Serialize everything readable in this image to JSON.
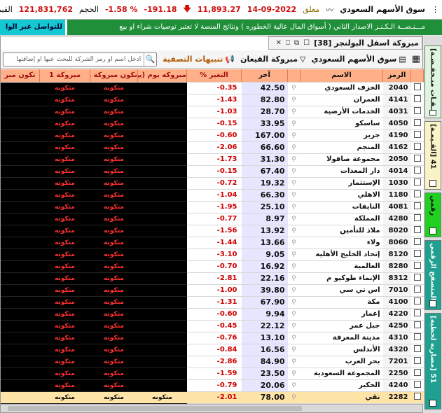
{
  "topbar": {
    "market_name": "سوق الأسهم السعودي",
    "status": "مغلق",
    "date": "14-09-2022",
    "index_value": "11,893.27",
    "index_change": "-191.18",
    "index_change_pct": "-1.58 %",
    "volume_label": "الحجم",
    "volume_value": "121,831,762",
    "value_label": "القيمة"
  },
  "banner": {
    "ticker_text": "مـــنـصــة الـكـنـز الاصدار الثاني ( أسواق المال عالية الخطوره ) ونتائج المنصة لا تعتبر توصيات شراء او بيع",
    "contact_label": "للتواصل عبر الوا"
  },
  "side_tabs": [
    {
      "label": "[صـفــقـات منـخفـضـة] 5"
    },
    {
      "label": "[القـيمـة] 41"
    },
    {
      "label": "رقمي"
    },
    {
      "label": "المتصفح الرقمي"
    },
    {
      "label": "[مضاربه لحظيه] 51"
    }
  ],
  "panel": {
    "title": "مبروكة اسفل البولنجر [38]",
    "toolbar": {
      "market_select": "سوق الأسهم السعودي",
      "filter_label": "مبروكة القيعان",
      "alerts_label": "تنبيهات التصفية",
      "search_placeholder": "ادخل اسم أو رمز الشركة للبحث عنها أو إضافتها"
    },
    "columns": {
      "symbol": "الرمز",
      "name": "الاسم",
      "last": "آخر",
      "change": "التغير %",
      "weekly": "مبروكه يوم (يوم)",
      "tkon_day": "تكون مبروكة يوم",
      "mabrouka1": "مبروكة 1",
      "tkon_m": "تكون مبر"
    },
    "cell_text": "متكونه",
    "rows": [
      {
        "symbol": "2040",
        "name": "الخزف السعودي",
        "last": "42.50",
        "change": "0.35-"
      },
      {
        "symbol": "4141",
        "name": "العمران",
        "last": "82.80",
        "change": "1.43-"
      },
      {
        "symbol": "4031",
        "name": "الخدمات الأرضية",
        "last": "28.70",
        "change": "1.03-"
      },
      {
        "symbol": "4050",
        "name": "ساسكو",
        "last": "33.95",
        "change": "0.15-"
      },
      {
        "symbol": "4190",
        "name": "جرير",
        "last": "167.00",
        "change": "0.60-"
      },
      {
        "symbol": "4162",
        "name": "المنجم",
        "last": "66.60",
        "change": "2.06-"
      },
      {
        "symbol": "2050",
        "name": "مجموعة صافولا",
        "last": "31.30",
        "change": "1.73-"
      },
      {
        "symbol": "4014",
        "name": "دار المعدات",
        "last": "67.40",
        "change": "0.15-"
      },
      {
        "symbol": "1030",
        "name": "الإستثمار",
        "last": "19.32",
        "change": "0.72-"
      },
      {
        "symbol": "1180",
        "name": "الاهلي",
        "last": "66.30",
        "change": "1.04-"
      },
      {
        "symbol": "4081",
        "name": "النايفات",
        "last": "25.10",
        "change": "1.95-"
      },
      {
        "symbol": "4280",
        "name": "المملكة",
        "last": "8.97",
        "change": "0.77-"
      },
      {
        "symbol": "8020",
        "name": "ملاذ للتأمين",
        "last": "13.92",
        "change": "1.56-"
      },
      {
        "symbol": "8060",
        "name": "ولاء",
        "last": "13.66",
        "change": "1.44-"
      },
      {
        "symbol": "8120",
        "name": "إتحاد الخليج الأهلية",
        "last": "9.05",
        "change": "3.10-"
      },
      {
        "symbol": "8280",
        "name": "العالمية",
        "last": "16.92",
        "change": "0.70-"
      },
      {
        "symbol": "8312",
        "name": "الإنماء طوكيو م",
        "last": "22.16",
        "change": "2.81-"
      },
      {
        "symbol": "7010",
        "name": "اس تي سي",
        "last": "39.80",
        "change": "1.00-"
      },
      {
        "symbol": "4100",
        "name": "مكة",
        "last": "67.90",
        "change": "1.31-"
      },
      {
        "symbol": "4220",
        "name": "إعمار",
        "last": "9.94",
        "change": "0.60-"
      },
      {
        "symbol": "4250",
        "name": "جبل عمر",
        "last": "22.12",
        "change": "0.45-"
      },
      {
        "symbol": "4310",
        "name": "مدينة المعرفة",
        "last": "13.10",
        "change": "0.76-"
      },
      {
        "symbol": "4320",
        "name": "الأندلس",
        "last": "16.56",
        "change": "0.84-"
      },
      {
        "symbol": "7201",
        "name": "بحر العرب",
        "last": "84.90",
        "change": "2.86-"
      },
      {
        "symbol": "2250",
        "name": "المجموعة السعودية",
        "last": "23.50",
        "change": "1.59-"
      },
      {
        "symbol": "4240",
        "name": "الحكير",
        "last": "20.06",
        "change": "0.79-"
      }
    ],
    "selected_row": {
      "symbol": "2282",
      "name": "نقي",
      "last": "78.00",
      "change": "2.01-",
      "weekly": "متكونه"
    }
  }
}
